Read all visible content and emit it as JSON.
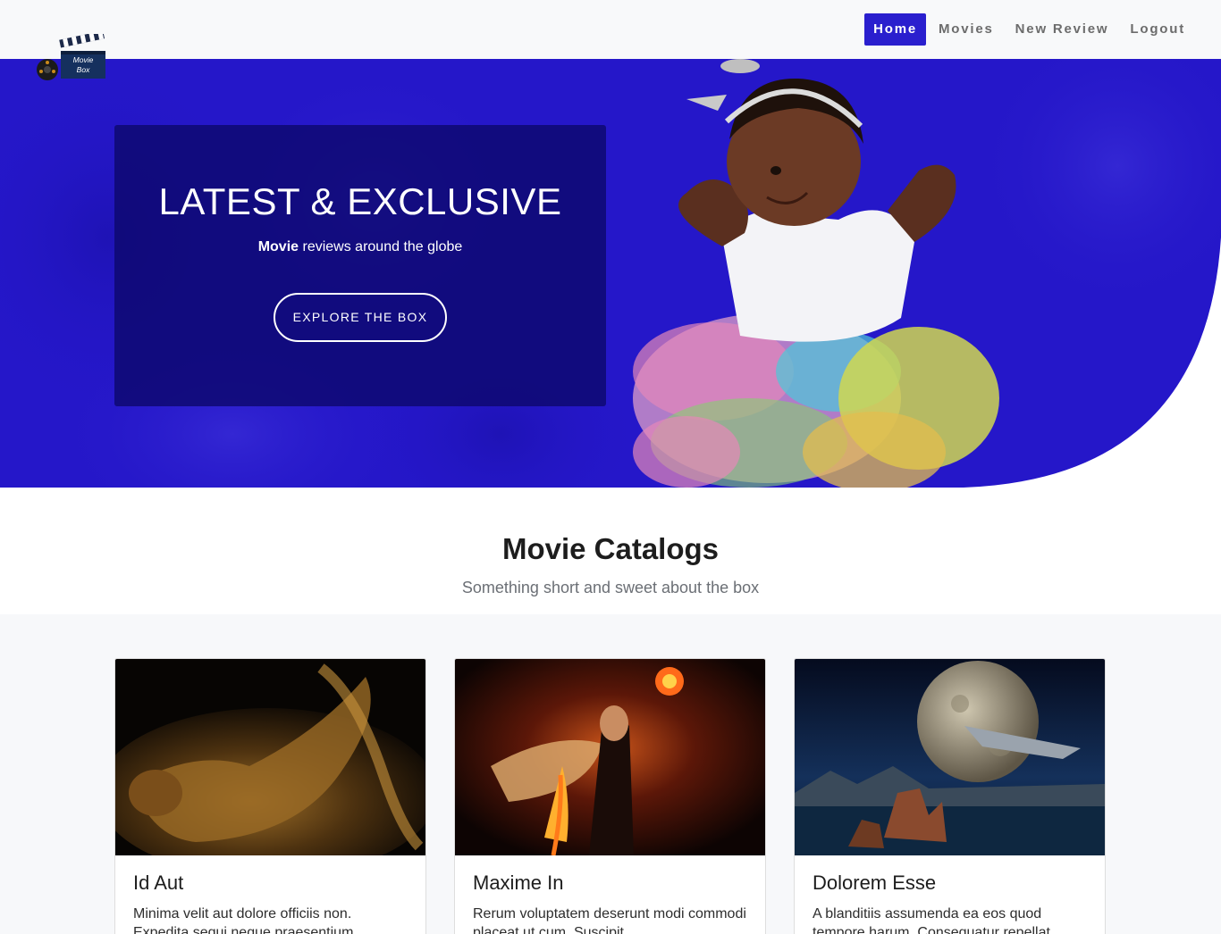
{
  "brand": {
    "logo_text_line1": "Movie",
    "logo_text_line2": "Box"
  },
  "nav": {
    "items": [
      {
        "label": "Home",
        "active": true
      },
      {
        "label": "Movies",
        "active": false
      },
      {
        "label": "New Review",
        "active": false
      },
      {
        "label": "Logout",
        "active": false
      }
    ]
  },
  "hero": {
    "title": "LATEST & EXCLUSIVE",
    "subtitle_bold": "Movie",
    "subtitle_rest": " reviews around the globe",
    "button_label": "EXPLORE THE BOX"
  },
  "catalog": {
    "title": "Movie Catalogs",
    "subtitle": "Something short and sweet about the box",
    "cards": [
      {
        "title": "Id Aut",
        "text": "Minima velit aut dolore officiis non. Expedita sequi neque praesentium aperiam."
      },
      {
        "title": "Maxime In",
        "text": "Rerum voluptatem deserunt modi commodi placeat ut cum. Suscipit."
      },
      {
        "title": "Dolorem Esse",
        "text": "A blanditiis assumenda ea eos quod tempore harum. Consequatur repellat."
      }
    ]
  },
  "colors": {
    "accent": "#2a1fce",
    "hero_bg": "#2517c9",
    "nav_bg": "#f8f9fa",
    "section_bg": "#f7f8fa"
  }
}
